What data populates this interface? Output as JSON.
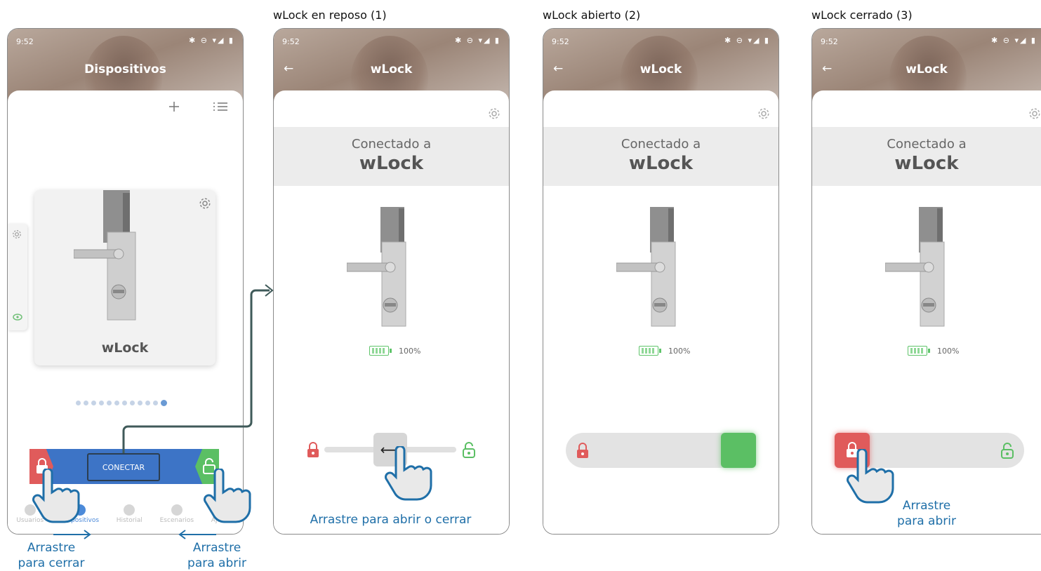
{
  "captions": {
    "reposo": "wLock en reposo (1)",
    "abierto": "wLock abierto (2)",
    "cerrado": "wLock cerrado (3)"
  },
  "status": {
    "time": "9:52",
    "icons": "✱ ⊖ ▾◢ ▮"
  },
  "screen1": {
    "title": "Dispositivos",
    "device_name": "wLock",
    "connect_label": "CONECTAR",
    "page_count": 12,
    "active_page": 12,
    "tabs": [
      {
        "label": "Usuarios",
        "icon": "users-icon"
      },
      {
        "label": "Dispositivos",
        "icon": "lock-icon"
      },
      {
        "label": "Historial",
        "icon": "history-icon"
      },
      {
        "label": "Escenarios",
        "icon": "scenes-icon"
      },
      {
        "label": "Ajustes",
        "icon": "settings-icon"
      }
    ],
    "annot_left_1": "Arrastre",
    "annot_left_2": "para cerrar",
    "annot_right_1": "Arrastre",
    "annot_right_2": "para abrir"
  },
  "detail": {
    "title": "wLock",
    "connected_prefix": "Conectado a",
    "connected_name": "wLock",
    "battery": "100%"
  },
  "screen2": {
    "hint": "Arrastre para abrir o cerrar",
    "handle_symbol": "⟷"
  },
  "screen4": {
    "hint_1": "Arrastre",
    "hint_2": "para abrir"
  },
  "colors": {
    "red": "#e05b5b",
    "green": "#5bbf64",
    "blue": "#3d74c6",
    "annot_blue": "#1f6fa8"
  }
}
